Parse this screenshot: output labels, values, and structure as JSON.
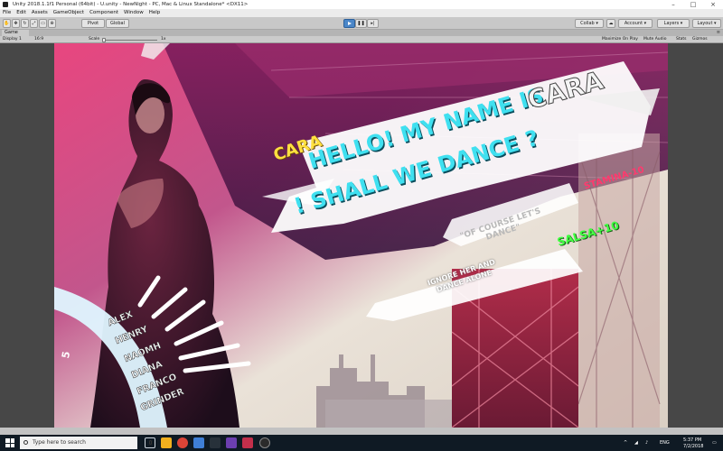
{
  "window": {
    "title": "Unity 2018.1.1f1 Personal (64bit) - U.unity - NewNight - PC, Mac & Linux Standalone* <DX11>"
  },
  "menu": [
    "File",
    "Edit",
    "Assets",
    "GameObject",
    "Component",
    "Window",
    "Help"
  ],
  "toolbar": {
    "pivot_label": "Pivot",
    "global_label": "Global",
    "collab_label": "Collab",
    "account_label": "Account",
    "layers_label": "Layers",
    "layout_label": "Layout"
  },
  "game_tab": {
    "label": "Game",
    "display_label": "Display 1",
    "aspect_label": "16:9",
    "scale_label": "Scale",
    "scale_value": "1x",
    "maximize_label": "Maximize On Play",
    "mute_label": "Mute Audio",
    "stats_label": "Stats",
    "gizmos_label": "Gizmos"
  },
  "game": {
    "speaker_name": "CARA",
    "dialogue_line1": "HELLO! MY NAME IS",
    "dialogue_name": "CARA",
    "dialogue_line2": "! SHALL WE DANCE ?",
    "stamina_badge": "STAMINA-10",
    "choice1": "\"OF COURSE LET'S",
    "choice1_line2": "DANCE\"",
    "salsa_badge": "SALSA+10",
    "choice2": "IGNORE HER AND",
    "choice2_line2": "DANCE ALONE",
    "roster": [
      "ALEX",
      "HENRY",
      "NAOMH",
      "DIANA",
      "FRANCO",
      "GRINDER"
    ],
    "arc_number": "5",
    "colors": {
      "speaker": "#ffe040",
      "dialogue": "#3fe0f0",
      "stamina": "#ff3a6e",
      "salsa": "#40ff40"
    }
  },
  "taskbar": {
    "search_placeholder": "Type here to search",
    "time": "5:37 PM",
    "date": "7/2/2018",
    "lang": "ENG"
  }
}
